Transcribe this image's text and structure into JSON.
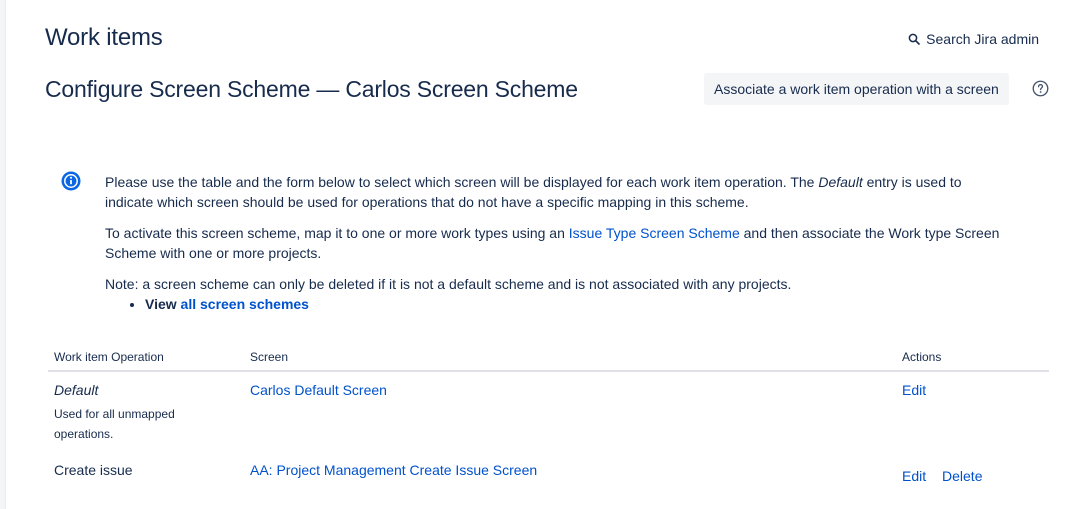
{
  "header": {
    "section_title": "Work items",
    "search_admin_label": "Search Jira admin"
  },
  "page": {
    "title": "Configure Screen Scheme — Carlos Screen Scheme",
    "associate_button_label": "Associate a work item operation with a screen"
  },
  "info": {
    "p1_before": "Please use the table and the form below to select which screen will be displayed for each work item operation. The ",
    "p1_em": "Default",
    "p1_after": " entry is used to indicate which screen should be used for operations that do not have a specific mapping in this scheme.",
    "p2_before": "To activate this screen scheme, map it to one or more work types using an ",
    "p2_link": "Issue Type Screen Scheme",
    "p2_after": " and then associate the Work type Screen Scheme with one or more projects.",
    "p3": "Note: a screen scheme can only be deleted if it is not a default scheme and is not associated with any projects.",
    "view_label": "View ",
    "view_link": "all screen schemes"
  },
  "table": {
    "headers": {
      "operation": "Work item Operation",
      "screen": "Screen",
      "actions": "Actions"
    },
    "rows": [
      {
        "operation": "Default",
        "description": "Used for all unmapped operations.",
        "screen": "Carlos Default Screen",
        "edit": "Edit"
      },
      {
        "operation": "Create issue",
        "screen": "AA: Project Management Create Issue Screen",
        "edit": "Edit",
        "delete": "Delete"
      }
    ]
  },
  "colors": {
    "text": "#172b4d",
    "link": "#0052cc",
    "button_bg": "#f4f5f7",
    "info_icon": "#0c66e4"
  }
}
